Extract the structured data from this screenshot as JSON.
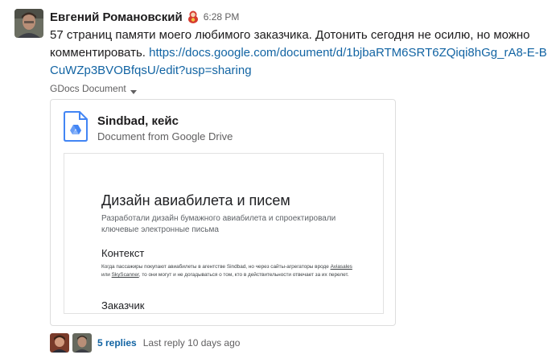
{
  "message": {
    "sender": "Евгений Романовский",
    "status_emoji": "matryoshka-icon",
    "timestamp": "6:28 PM",
    "text": "57 страниц памяти моего любимого заказчика. Дотонить сегодня не осилю, но можно комментировать.",
    "link": "https://docs.google.com/document/d/1bjbaRTM6SRT6ZQiqi8hGg_rA8-E-BCuWZp3BVOBfqsU/edit?usp=sharing"
  },
  "attachment": {
    "label": "GDocs Document",
    "title": "Sindbad, кейс",
    "subtitle": "Document from Google Drive",
    "preview": {
      "title": "Дизайн авиабилета и писем",
      "subtitle": "Разработали дизайн бумажного авиабилета и спроектировали ключевые электронные письма",
      "heading1": "Контекст",
      "para_part1": "Когда пассажиры покупают авиабилеты в агентстве Sindbad, но через сайты-агрегаторы вроде ",
      "para_link1": "Aviasales",
      "para_part2": " или ",
      "para_link2": "SkyScanner",
      "para_part3": ", то они могут и не догадываться о том, кто в действительности отвечает за их перелет.",
      "heading2": "Заказчик"
    }
  },
  "thread": {
    "replies": "5 replies",
    "last_reply": "Last reply 10 days ago"
  },
  "colors": {
    "link": "#1264a3",
    "text": "#1d1c1d",
    "muted": "#616061",
    "gdocs_blue": "#4285f4"
  }
}
